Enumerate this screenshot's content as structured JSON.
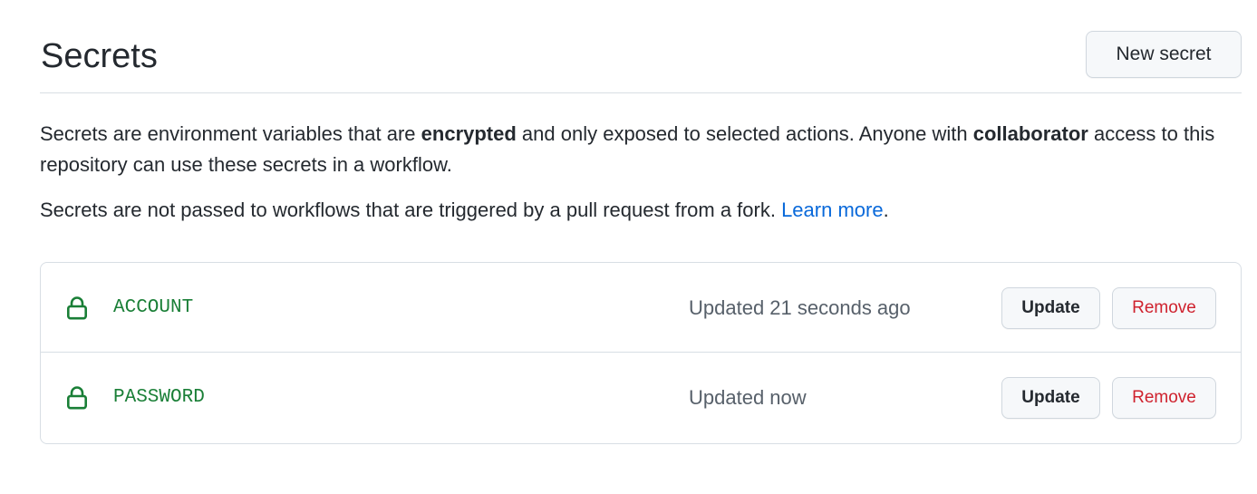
{
  "header": {
    "title": "Secrets",
    "new_secret_label": "New secret"
  },
  "description": {
    "line1_part1": "Secrets are environment variables that are ",
    "line1_bold1": "encrypted",
    "line1_part2": " and only exposed to selected actions. Anyone with ",
    "line1_bold2": "collaborator",
    "line1_part3": " access to this repository can use these secrets in a workflow.",
    "line2_text": "Secrets are not passed to workflows that are triggered by a pull request from a fork. ",
    "line2_link": "Learn more",
    "line2_end": "."
  },
  "secrets": [
    {
      "name": "ACCOUNT",
      "updated": "Updated 21 seconds ago",
      "update_label": "Update",
      "remove_label": "Remove",
      "icon": "lock-icon"
    },
    {
      "name": "PASSWORD",
      "updated": "Updated now",
      "update_label": "Update",
      "remove_label": "Remove",
      "icon": "lock-icon"
    }
  ],
  "colors": {
    "secret_name": "#1a7f37",
    "link": "#0969da",
    "danger": "#cf222e",
    "muted": "#57606a"
  }
}
